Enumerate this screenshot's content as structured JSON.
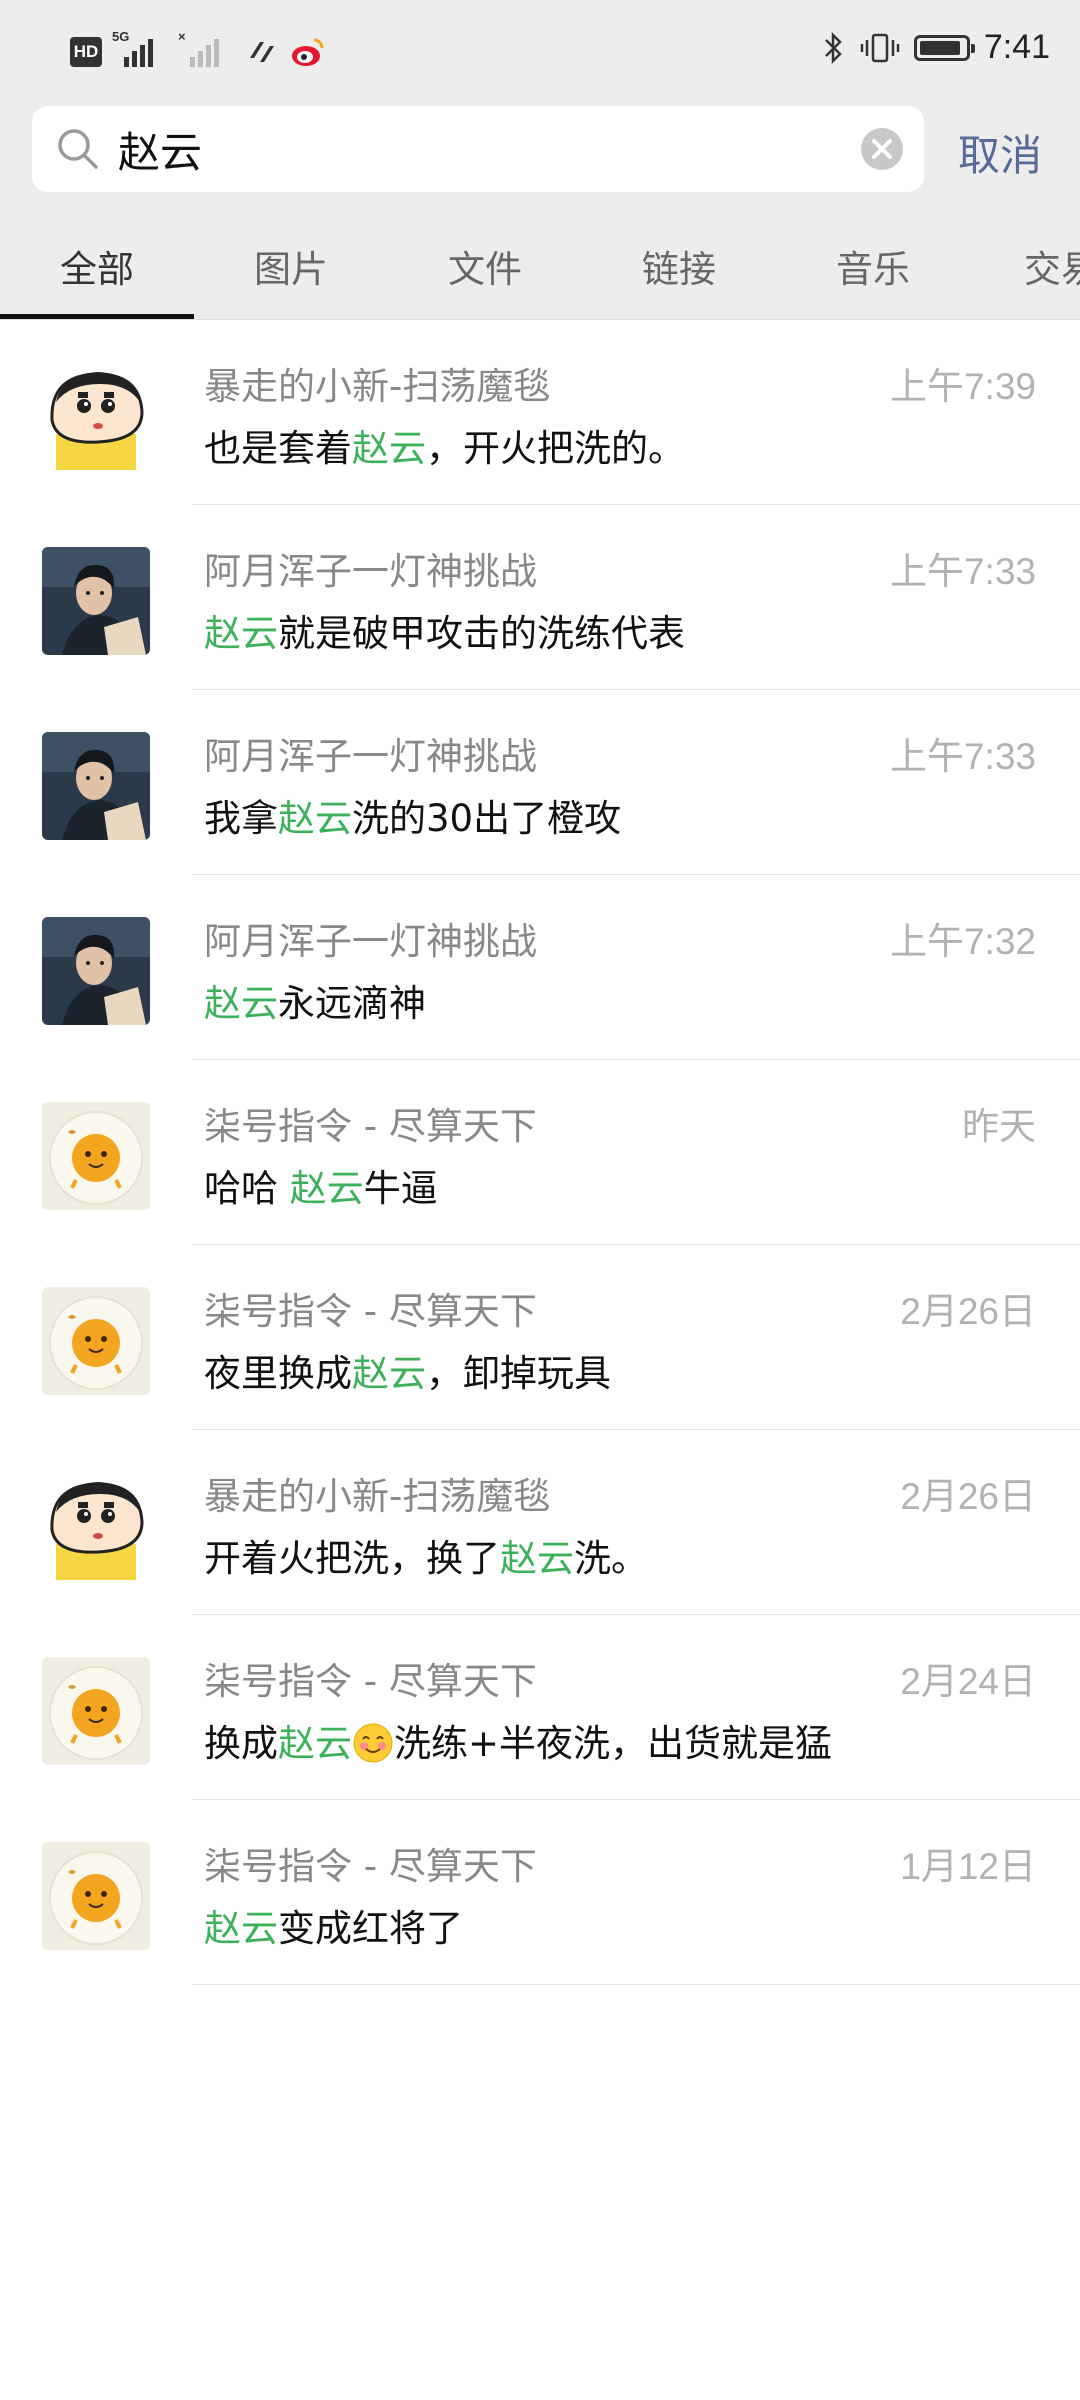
{
  "status_bar": {
    "hd_label": "HD",
    "signal_tag": "5G",
    "signal2_tag": "×",
    "time": "7:41",
    "icons": [
      "hd-icon",
      "signal-icon",
      "signal-icon",
      "link-icon",
      "weibo-icon",
      "bluetooth-icon",
      "vibrate-icon",
      "battery-icon"
    ]
  },
  "search": {
    "query": "赵云",
    "cancel_label": "取消"
  },
  "tabs": [
    "全部",
    "图片",
    "文件",
    "链接",
    "音乐",
    "交易"
  ],
  "active_tab": "全部",
  "colors": {
    "highlight": "#3cb15a",
    "link": "#576b95",
    "header_bg": "#ededed"
  },
  "results": [
    {
      "name": "暴走的小新-扫荡魔毯",
      "time": "上午7:39",
      "avatar": "shinchan-avatar",
      "pre": "也是套着",
      "kw": "赵云",
      "post": "，开火把洗的。"
    },
    {
      "name": "阿月浑子一灯神挑战",
      "time": "上午7:33",
      "avatar": "portrait-avatar",
      "pre": "",
      "kw": "赵云",
      "post": "就是破甲攻击的洗练代表"
    },
    {
      "name": "阿月浑子一灯神挑战",
      "time": "上午7:33",
      "avatar": "portrait-avatar",
      "pre": "我拿",
      "kw": "赵云",
      "post": "洗的30出了橙攻"
    },
    {
      "name": "阿月浑子一灯神挑战",
      "time": "上午7:32",
      "avatar": "portrait-avatar",
      "pre": "",
      "kw": "赵云",
      "post": "永远滴神"
    },
    {
      "name": "柒号指令 - 尽算天下",
      "time": "昨天",
      "avatar": "cartoon-ball-avatar",
      "pre": "哈哈 ",
      "kw": "赵云",
      "post": "牛逼"
    },
    {
      "name": "柒号指令 - 尽算天下",
      "time": "2月26日",
      "avatar": "cartoon-ball-avatar",
      "pre": "夜里换成",
      "kw": "赵云",
      "post": "，卸掉玩具"
    },
    {
      "name": "暴走的小新-扫荡魔毯",
      "time": "2月26日",
      "avatar": "shinchan-avatar",
      "pre": "开着火把洗，换了",
      "kw": "赵云",
      "post": "洗。"
    },
    {
      "name": "柒号指令 - 尽算天下",
      "time": "2月24日",
      "avatar": "cartoon-ball-avatar",
      "pre": "换成",
      "kw": "赵云",
      "emoji": "blush-emoji",
      "post": "洗练+半夜洗，出货就是猛"
    },
    {
      "name": "柒号指令 - 尽算天下",
      "time": "1月12日",
      "avatar": "cartoon-ball-avatar",
      "pre": "",
      "kw": "赵云",
      "post": "变成红将了"
    }
  ]
}
